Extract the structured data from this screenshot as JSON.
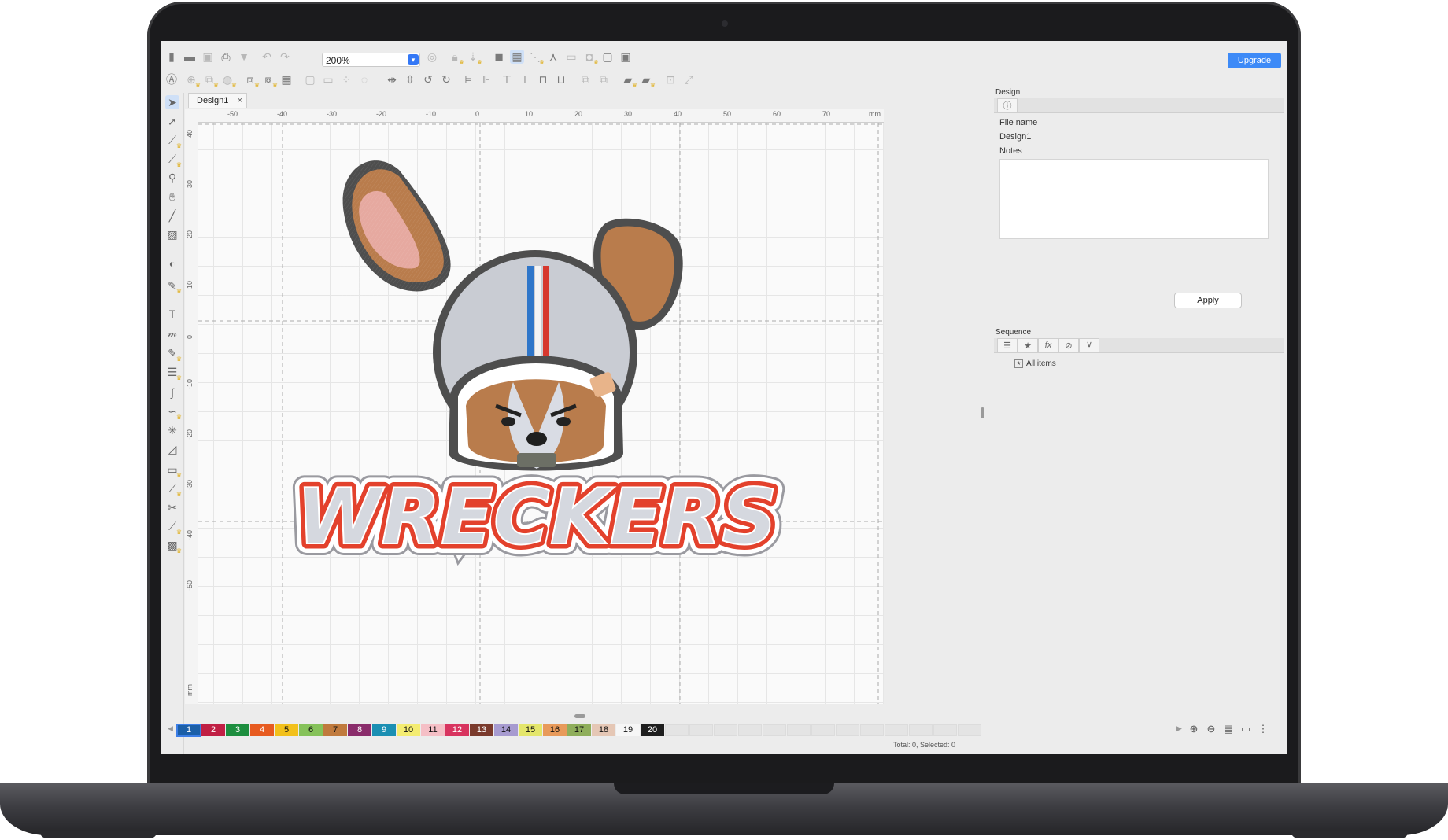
{
  "toolbar": {
    "zoom_value": "200%",
    "upgrade_label": "Upgrade"
  },
  "document_tab": {
    "label": "Design1",
    "close_glyph": "×"
  },
  "rulers": {
    "top_ticks": [
      "-50",
      "-40",
      "-30",
      "-20",
      "-10",
      "0",
      "10",
      "20",
      "30",
      "40",
      "50",
      "60",
      "70"
    ],
    "top_unit": "mm",
    "left_ticks": [
      "40",
      "30",
      "20",
      "10",
      "0",
      "-10",
      "-20",
      "-30",
      "-40",
      "-50"
    ],
    "left_unit": "mm"
  },
  "design_panel": {
    "title": "Design",
    "file_name_label": "File name",
    "file_name_value": "Design1",
    "notes_label": "Notes",
    "notes_value": "",
    "apply_label": "Apply"
  },
  "sequence_panel": {
    "title": "Sequence",
    "tabs": [
      "list-icon",
      "star-icon",
      "fx-icon",
      "compass-icon",
      "cart-icon"
    ],
    "root_item": "All items"
  },
  "artwork": {
    "text": "WRECKERS"
  },
  "palette": [
    {
      "label": "1",
      "color": "#1b5fa8"
    },
    {
      "label": "2",
      "color": "#c01f44"
    },
    {
      "label": "3",
      "color": "#1d8e3f"
    },
    {
      "label": "4",
      "color": "#e75b20"
    },
    {
      "label": "5",
      "color": "#f2c01b"
    },
    {
      "label": "6",
      "color": "#86c25a"
    },
    {
      "label": "7",
      "color": "#c07a3d"
    },
    {
      "label": "8",
      "color": "#8a2c6b"
    },
    {
      "label": "9",
      "color": "#1b8fb3"
    },
    {
      "label": "10",
      "color": "#f4ec71"
    },
    {
      "label": "11",
      "color": "#f5bfc6"
    },
    {
      "label": "12",
      "color": "#d8345f"
    },
    {
      "label": "13",
      "color": "#7a3a2c"
    },
    {
      "label": "14",
      "color": "#a79bd0"
    },
    {
      "label": "15",
      "color": "#e4e66b"
    },
    {
      "label": "16",
      "color": "#e89a5a"
    },
    {
      "label": "17",
      "color": "#8fae5b"
    },
    {
      "label": "18",
      "color": "#e5c7b5"
    },
    {
      "label": "19",
      "color": "#f6f6f6"
    },
    {
      "label": "20",
      "color": "#1e1e1e"
    }
  ],
  "status": {
    "text": "Total: 0, Selected: 0"
  }
}
